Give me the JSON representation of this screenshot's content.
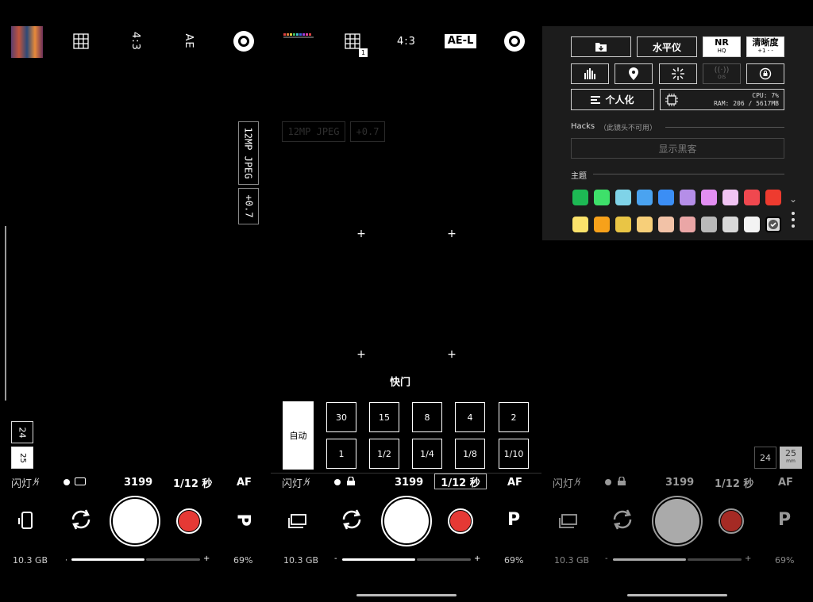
{
  "left": {
    "aspect": "4:3",
    "exposure": "AE",
    "tele_lens_label": "24",
    "wide_lens_label": "25",
    "wide_lens_unit": "mm",
    "flash_label": "闪灯",
    "iso": "3199",
    "shutter": "1/12 秒",
    "focus": "AF",
    "mode": "P",
    "storage": "10.3 GB",
    "battery": "69%",
    "format_label": "12MP JPEG",
    "ev_label": "+0.7"
  },
  "middle": {
    "aspect": "4:3",
    "exposure": "AE-L",
    "grid_badge": "1",
    "faded_format": "12MP JPEG",
    "faded_ev": "+0.7",
    "shutter_title": "快门",
    "auto_label": "自动",
    "speed_row1": [
      "30",
      "15",
      "8",
      "4",
      "2"
    ],
    "speed_row2": [
      "1",
      "1/2",
      "1/4",
      "1/8",
      "1/10"
    ],
    "flash_label": "闪灯",
    "iso": "3199",
    "shutter": "1/12 秒",
    "focus": "AF",
    "mode": "P",
    "storage": "10.3 GB",
    "battery": "69%"
  },
  "right": {
    "flash_label": "闪灯",
    "iso": "3199",
    "shutter": "1/12 秒",
    "focus": "AF",
    "mode": "P",
    "storage": "10.3 GB",
    "battery": "69%",
    "lens_24": "24",
    "lens_25": "25",
    "lens_25_unit": "mm"
  },
  "quick_settings": {
    "level_label": "水平仪",
    "nr_label": "NR",
    "nr_sub": "HQ",
    "sharpness_label": "清晰度",
    "sharpness_sub": "+1 - -",
    "ois_label": "OIS",
    "personalize_label": "个人化",
    "cpu_text": "CPU: 7%",
    "ram_text": "RAM: 206 / 5617MB",
    "hacks_title": "Hacks",
    "hacks_note": "（此镜头不可用）",
    "show_hacks_label": "显示黑客",
    "theme_title": "主题",
    "theme_colors_row1": [
      "#1db954",
      "#3ee06a",
      "#7fd3e8",
      "#4aa3f0",
      "#3b8ef5",
      "#b58ee8",
      "#e28ef2",
      "#f0c3f2",
      "#f0484f",
      "#ee3b2f"
    ],
    "theme_colors_row2": [
      "#fbe26b",
      "#f7a11a",
      "#e9c545",
      "#f7cf79",
      "#f2c2a7",
      "#eaa6a6",
      "#b9b9b9",
      "#d8d8d8",
      "#f3f3f3",
      "#dcdcdc"
    ]
  }
}
